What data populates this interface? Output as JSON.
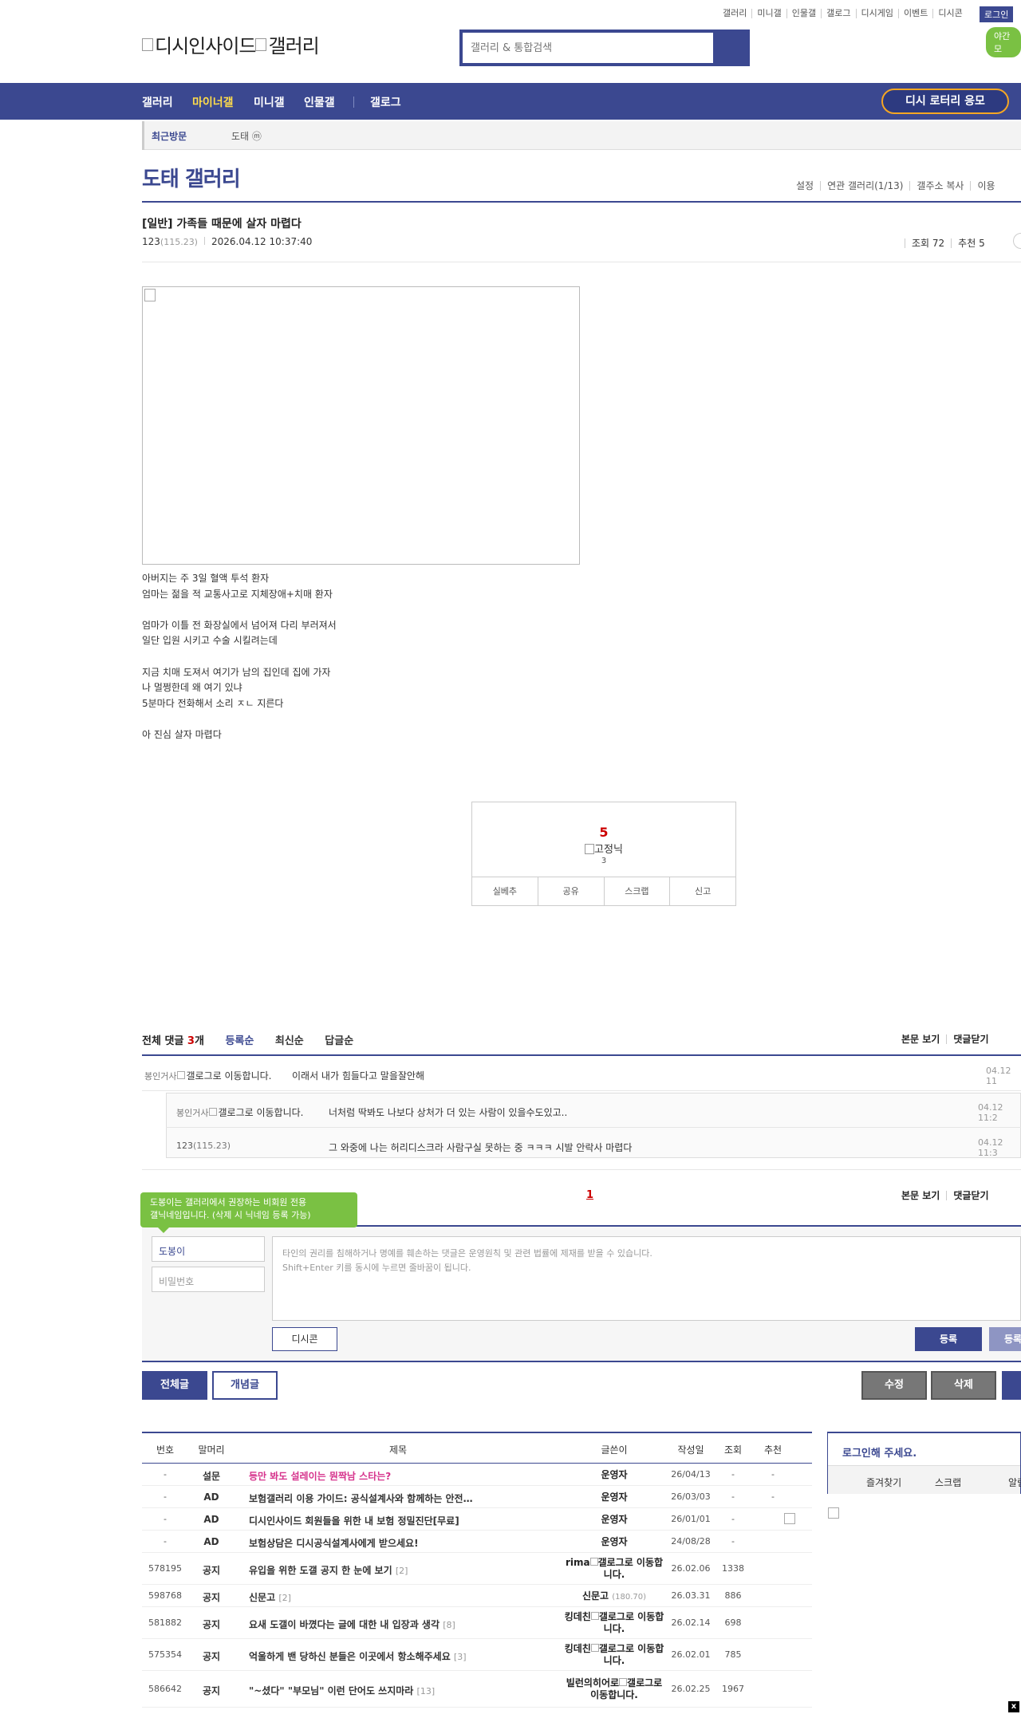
{
  "util_links": [
    "갤러리",
    "미니갤",
    "인물갤",
    "갤로그",
    "디시게임",
    "이벤트",
    "디시콘"
  ],
  "login_label": "로그인",
  "night_label": "야간 모",
  "logo_text": "디시인사이드",
  "logo_gallery_text": "갤러리",
  "search_placeholder": "갤러리 & 통합검색",
  "nav": {
    "items": [
      "갤러리",
      "마이너갤",
      "미니갤",
      "인물갤",
      "갤로그"
    ],
    "active": "마이너갤",
    "lotto": "디시 로터리 응모"
  },
  "recent_visit": {
    "label": "최근방문",
    "item": "도태 ⓜ"
  },
  "gallery_title": "도태 갤러리",
  "gallery_menu": [
    "설정",
    "연관 갤러리(1/13)",
    "갤주소 복사",
    "이용"
  ],
  "post": {
    "title": "[일반] 가족들 때문에 살자 마렵다",
    "author": "123",
    "author_ip": "(115.23)",
    "datetime": "2026.04.12 10:37:40",
    "views": "조회 72",
    "recommend": "추천 5",
    "body_lines": [
      "아버지는 주 3일 혈액 투석 환자",
      "엄마는 젊을 적 교통사고로 지체장애+치매 환자",
      "",
      "엄마가 이틀 전 화장실에서 넘어져 다리 부러져서",
      "일단 입원 시키고 수술 시킬려는데",
      "",
      "지금 치매 도져서 여기가 남의 집인데 집에 가자",
      "나 멀쩡한데 왜 여기 있냐",
      "5분마다 전화해서 소리 ㅈㄴ 지른다",
      "",
      "아 진심 살자 마렵다"
    ]
  },
  "recommend_box": {
    "count": "5",
    "fix_label": "고정닉",
    "fix_count": "3",
    "buttons": [
      "실베추",
      "공유",
      "스크랩",
      "신고"
    ]
  },
  "comments": {
    "total_label": "전체 댓글",
    "total_count": "3",
    "unit": "개",
    "sorts": [
      "등록순",
      "최신순",
      "답글순"
    ],
    "right_links": [
      "본문 보기",
      "댓글닫기"
    ],
    "items": [
      {
        "nick": "봉인거사",
        "gallog": "갤로그로 이동합니다.",
        "text": "이래서 내가 힘들다고 말을잘안해",
        "date": "04.12 11"
      },
      {
        "nick": "봉인거사",
        "gallog": "갤로그로 이동합니다.",
        "text": "너처럼 딱봐도 나보다 상처가 더 있는 사람이 있을수도있고..",
        "date": "04.12 11:2"
      },
      {
        "nick": "123",
        "ip": "(115.23)",
        "text": "그 와중에 나는 허리디스크라 사람구실 못하는 중 ㅋㅋㅋ 시발 안락사 마렵다",
        "date": "04.12 11:3"
      }
    ],
    "page": "1"
  },
  "write": {
    "tooltip_line1": "도봉이는 갤러리에서 권장하는 비회원 전용",
    "tooltip_line2": "갤닉네임입니다. (삭제 시 닉네임 등록 가능)",
    "nick_value": "도봉이",
    "password_placeholder": "비밀번호",
    "notice_line1": "타인의 권리를 침해하거나 명예를 훼손하는 댓글은 운영원칙 및 관련 법률에 제재를 받을 수 있습니다.",
    "notice_line2": "Shift+Enter 키를 동시에 누르면 줄바꿈이 됩니다.",
    "dccon": "디시콘",
    "submit": "등록",
    "submit2": "등록"
  },
  "list_buttons": {
    "all": "전체글",
    "concept": "개념글",
    "edit": "수정",
    "delete": "삭제"
  },
  "table": {
    "headers": [
      "번호",
      "말머리",
      "제목",
      "글쓴이",
      "작성일",
      "조회",
      "추천"
    ],
    "rows": [
      {
        "num": "-",
        "head": "설문",
        "subject": "등만 봐도 설레이는 뭔짝남 스타는?",
        "rc": "",
        "writer": "운영자",
        "date": "26/04/13",
        "views": "-",
        "rec": "-",
        "pink": true
      },
      {
        "num": "-",
        "head": "AD",
        "subject": "보험갤러리 이용 가이드: 공식설계사와 함께하는 안전…",
        "rc": "",
        "writer": "운영자",
        "date": "26/03/03",
        "views": "-",
        "rec": "-"
      },
      {
        "num": "-",
        "head": "AD",
        "subject": "디시인사이드 회원들을 위한 내 보험 정밀진단[무료]",
        "rc": "",
        "writer": "운영자",
        "date": "26/01/01",
        "views": "-",
        "rec": ""
      },
      {
        "num": "-",
        "head": "AD",
        "subject": "보험상담은 디시공식설계사에게 받으세요!",
        "rc": "",
        "writer": "운영자",
        "date": "24/08/28",
        "views": "-",
        "rec": ""
      },
      {
        "num": "578195",
        "head": "공지",
        "subject": "유입을 위한 도갤 공지 한 눈에 보기",
        "rc": "[2]",
        "writer": "rima",
        "gallog": "갤로그로 이동합니다.",
        "date": "26.02.06",
        "views": "1338",
        "rec": ""
      },
      {
        "num": "598768",
        "head": "공지",
        "subject": "신문고",
        "rc": "[2]",
        "writer": "신문고",
        "ip": "(180.70)",
        "date": "26.03.31",
        "views": "886",
        "rec": ""
      },
      {
        "num": "581882",
        "head": "공지",
        "subject": "요새 도갤이 바꼈다는 글에 대한 내 입장과 생각",
        "rc": "[8]",
        "writer": "킹데친",
        "gallog": "갤로그로 이동합니다.",
        "date": "26.02.14",
        "views": "698",
        "rec": ""
      },
      {
        "num": "575354",
        "head": "공지",
        "subject": "억울하게 밴 당하신 분들은 이곳에서 항소해주세요",
        "rc": "[3]",
        "writer": "킹데친",
        "gallog": "갤로그로 이동합니다.",
        "date": "26.02.01",
        "views": "785",
        "rec": ""
      },
      {
        "num": "586642",
        "head": "공지",
        "subject": "\"~셨다\" \"부모님\" 이런 단어도 쓰지마라",
        "rc": "[13]",
        "writer": "빌런의히어로",
        "gallog": "갤로그로 이동합니다.",
        "date": "26.02.25",
        "views": "1967",
        "rec": ""
      }
    ]
  },
  "login_box": {
    "title": "로그인해 주세요.",
    "links": [
      "즐겨찾기",
      "스크랩",
      "알림"
    ]
  },
  "close_label": "x"
}
